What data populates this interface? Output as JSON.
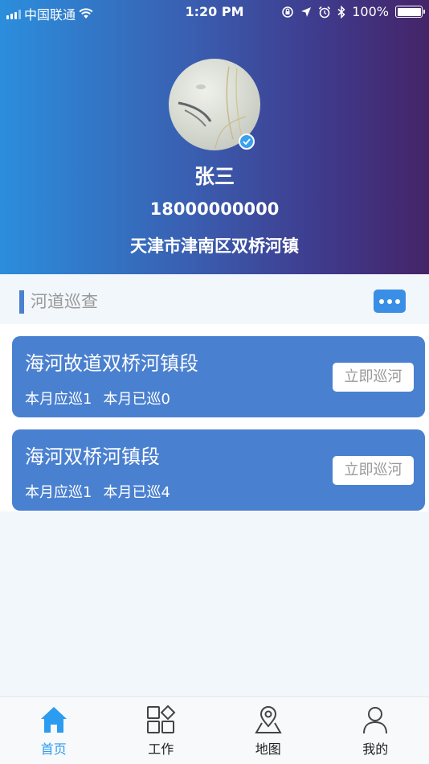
{
  "status_bar": {
    "carrier": "中国联通",
    "time": "1:20 PM",
    "battery": "100%"
  },
  "profile": {
    "name": "张三",
    "phone": "18000000000",
    "address": "天津市津南区双桥河镇"
  },
  "section": {
    "title": "河道巡查"
  },
  "rivers": [
    {
      "name": "海河故道双桥河镇段",
      "should_patrol": "本月应巡1",
      "patrolled": "本月已巡0",
      "button": "立即巡河"
    },
    {
      "name": "海河双桥河镇段",
      "should_patrol": "本月应巡1",
      "patrolled": "本月已巡4",
      "button": "立即巡河"
    }
  ],
  "tabs": [
    {
      "label": "首页",
      "icon": "home-icon",
      "active": true
    },
    {
      "label": "工作",
      "icon": "grid-icon",
      "active": false
    },
    {
      "label": "地图",
      "icon": "map-icon",
      "active": false
    },
    {
      "label": "我的",
      "icon": "user-icon",
      "active": false
    }
  ],
  "colors": {
    "accent": "#4a80d0",
    "active_tab": "#2b9cf0"
  }
}
